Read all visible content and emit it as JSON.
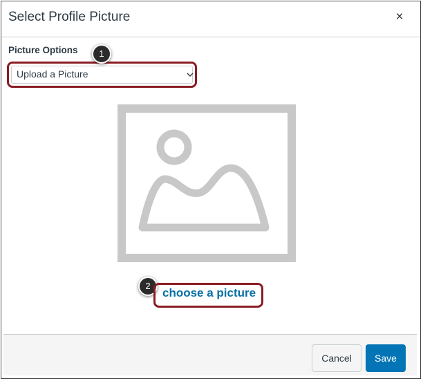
{
  "dialog": {
    "title": "Select Profile Picture",
    "close_icon": "close-icon",
    "close_glyph": "×"
  },
  "picture_options": {
    "label": "Picture Options",
    "selected": "Upload a Picture"
  },
  "callouts": [
    "1",
    "2"
  ],
  "upload": {
    "link_text": "choose a picture",
    "placeholder_icon": "image-placeholder-icon"
  },
  "footer": {
    "cancel_label": "Cancel",
    "save_label": "Save"
  },
  "colors": {
    "primary_button": "#0374b5",
    "link": "#0770a3",
    "highlight_outline": "#8b1c24",
    "placeholder_gray": "#c8c8c8"
  }
}
